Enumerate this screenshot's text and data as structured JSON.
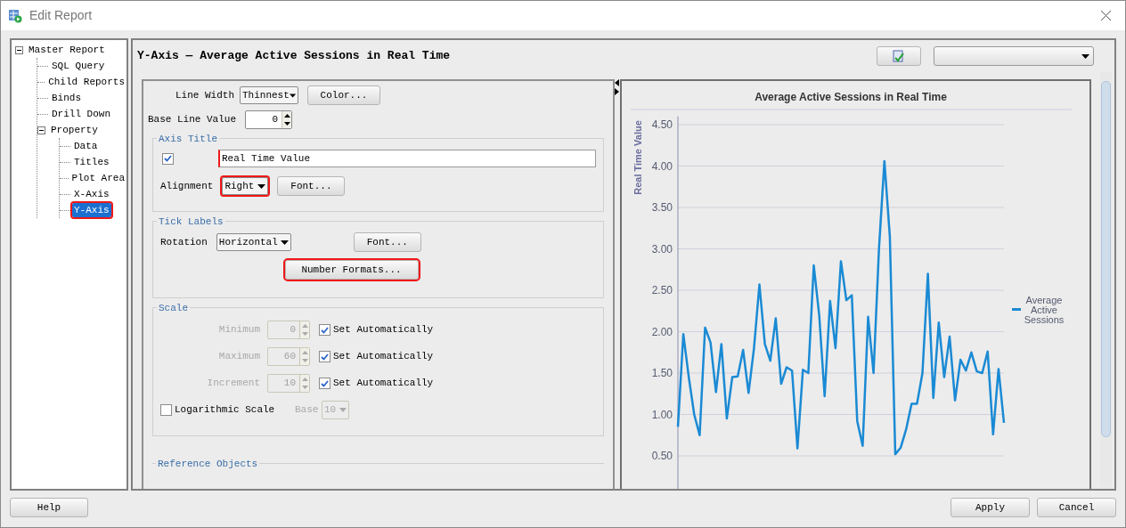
{
  "window": {
    "title": "Edit Report"
  },
  "tree": [
    {
      "label": "Master Report",
      "expanded": true,
      "selected": false,
      "highlighted": false,
      "children": [
        {
          "label": "SQL Query",
          "selected": false,
          "highlighted": false
        },
        {
          "label": "Child Reports",
          "selected": false,
          "highlighted": false
        },
        {
          "label": "Binds",
          "selected": false,
          "highlighted": false
        },
        {
          "label": "Drill Down",
          "selected": false,
          "highlighted": false
        },
        {
          "label": "Property",
          "expanded": true,
          "selected": false,
          "highlighted": false,
          "children": [
            {
              "label": "Data",
              "selected": false,
              "highlighted": false
            },
            {
              "label": "Titles",
              "selected": false,
              "highlighted": false
            },
            {
              "label": "Plot Area",
              "selected": false,
              "highlighted": false
            },
            {
              "label": "X-Axis",
              "selected": false,
              "highlighted": false
            },
            {
              "label": "Y-Axis",
              "selected": true,
              "highlighted": true
            }
          ]
        }
      ]
    }
  ],
  "header": {
    "title": "Y-Axis — Average Active Sessions in Real Time"
  },
  "form": {
    "line_width": {
      "label": "Line Width",
      "value": "Thinnest",
      "button": "Color..."
    },
    "base_line": {
      "label": "Base Line Value",
      "value": "0"
    },
    "axis_title": {
      "legend": "Axis Title",
      "checked": true,
      "value": "Real Time Value",
      "value_highlighted": true,
      "alignment_label": "Alignment",
      "alignment": "Right",
      "alignment_highlighted": true,
      "font_button": "Font..."
    },
    "tick_labels": {
      "legend": "Tick Labels",
      "rotation_label": "Rotation",
      "rotation": "Horizontal",
      "font_button": "Font...",
      "number_formats_button": "Number Formats...",
      "number_formats_highlighted": true
    },
    "scale": {
      "legend": "Scale",
      "rows": [
        {
          "label": "Minimum",
          "value": "0",
          "disabled": true,
          "auto_label": "Set Automatically",
          "checked": true
        },
        {
          "label": "Maximum",
          "value": "60",
          "disabled": true,
          "auto_label": "Set Automatically",
          "checked": true
        },
        {
          "label": "Increment",
          "value": "10",
          "disabled": true,
          "auto_label": "Set Automatically",
          "checked": true
        }
      ],
      "log": {
        "label": "Logarithmic Scale",
        "checked": false
      },
      "base": {
        "label": "Base",
        "value": "10",
        "disabled": true
      }
    },
    "reference_legend": "Reference Objects"
  },
  "chart": {
    "chart_data": {
      "type": "line",
      "grid": true,
      "title": "Average Active Sessions in Real Time",
      "ylabel": "Real Time Value",
      "ylim": [
        0.06,
        4.6
      ],
      "yticks": [
        {
          "value": 0.5,
          "label": "0.50"
        },
        {
          "value": 1,
          "label": "1.00"
        },
        {
          "value": 1.5,
          "label": "1.50"
        },
        {
          "value": 2,
          "label": "2.00"
        },
        {
          "value": 2.5,
          "label": "2.50"
        },
        {
          "value": 3,
          "label": "3.00"
        },
        {
          "value": 3.5,
          "label": "3.50"
        },
        {
          "value": 4,
          "label": "4.00"
        },
        {
          "value": 4.5,
          "label": "4.50"
        }
      ],
      "series": [
        {
          "name": "Average Active Sessions",
          "color": "#1a8ad4",
          "values": [
            0.85,
            1.97,
            1.45,
            1.0,
            0.75,
            2.05,
            1.87,
            1.27,
            1.85,
            0.95,
            1.45,
            1.46,
            1.78,
            1.26,
            1.8,
            2.57,
            1.85,
            1.65,
            2.16,
            1.37,
            1.57,
            1.53,
            0.59,
            1.54,
            1.5,
            2.8,
            2.2,
            1.22,
            2.37,
            1.8,
            2.85,
            2.38,
            2.44,
            0.92,
            0.62,
            2.18,
            1.5,
            3.0,
            4.06,
            3.15,
            0.52,
            0.6,
            0.82,
            1.13,
            1.13,
            1.5,
            2.7,
            1.2,
            2.11,
            1.45,
            1.94,
            1.17,
            1.66,
            1.53,
            1.75,
            1.52,
            1.5,
            1.76,
            0.76,
            1.55,
            0.9
          ]
        }
      ]
    }
  },
  "buttons": {
    "help": "Help",
    "apply": "Apply",
    "cancel": "Cancel"
  }
}
